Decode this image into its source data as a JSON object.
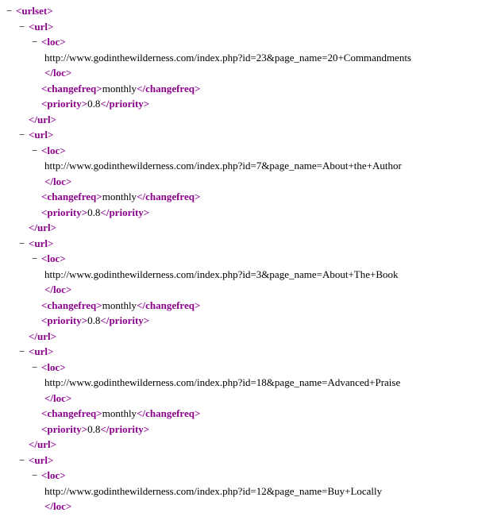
{
  "toggle": "−",
  "angle_open": "<",
  "angle_close": ">",
  "angle_close_slash": "</",
  "tag_urlset": "urlset",
  "tag_url": "url",
  "tag_loc": "loc",
  "tag_changefreq": "changefreq",
  "tag_priority": "priority",
  "urls": [
    {
      "loc": "http://www.godinthewilderness.com/index.php?id=23&page_name=20+Commandments",
      "changefreq": "monthly",
      "priority": "0.8",
      "complete": true
    },
    {
      "loc": "http://www.godinthewilderness.com/index.php?id=7&page_name=About+the+Author",
      "changefreq": "monthly",
      "priority": "0.8",
      "complete": true
    },
    {
      "loc": "http://www.godinthewilderness.com/index.php?id=3&page_name=About+The+Book",
      "changefreq": "monthly",
      "priority": "0.8",
      "complete": true
    },
    {
      "loc": "http://www.godinthewilderness.com/index.php?id=18&page_name=Advanced+Praise",
      "changefreq": "monthly",
      "priority": "0.8",
      "complete": true
    },
    {
      "loc": "http://www.godinthewilderness.com/index.php?id=12&page_name=Buy+Locally",
      "changefreq": "",
      "priority": "",
      "complete": false
    }
  ]
}
